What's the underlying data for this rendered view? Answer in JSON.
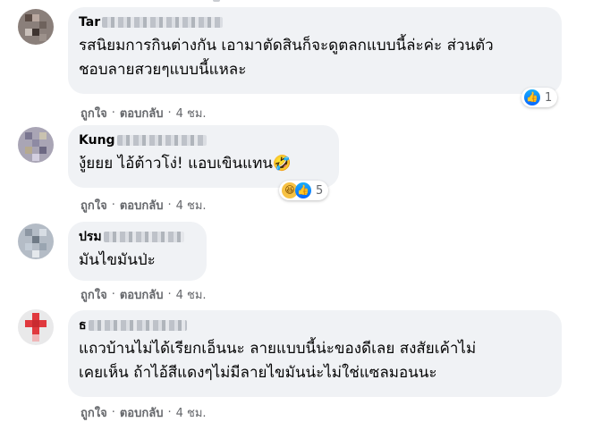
{
  "comments": [
    {
      "author_visible": "Tar",
      "text_lines": [
        "รสนิยมการกินต่างกัน เอามาตัดสินก็จะดูตลกแบบนี้ล่ะค่ะ ส่วนตัว",
        "ชอบลายสวยๆแบบนี้แหละ"
      ],
      "like_label": "ถูกใจ",
      "reply_label": "ตอบกลับ",
      "time": "4 ชม.",
      "reactions": {
        "icons": [
          "like-icon"
        ],
        "count": "1"
      }
    },
    {
      "author_visible": "Kung",
      "text_lines": [
        "งู้ยยย ไอ้ต้าวโง่! แอบเขินแทน🤣"
      ],
      "like_label": "ถูกใจ",
      "reply_label": "ตอบกลับ",
      "time": "4 ชม.",
      "reactions": {
        "icons": [
          "haha-icon",
          "like-icon"
        ],
        "count": "5"
      }
    },
    {
      "author_visible": "ปรม",
      "text_lines": [
        "มันไขมันป่ะ"
      ],
      "like_label": "ถูกใจ",
      "reply_label": "ตอบกลับ",
      "time": "4 ชม."
    },
    {
      "author_visible": "ธ",
      "text_lines": [
        "แถวบ้านไม่ได้เรียกเอ็นนะ ลายแบบนี้น่ะของดีเลย สงสัยเค้าไม่",
        "เคยเห็น ถ้าไอ้สีแดงๆไม่มีลายไขมันน่ะไม่ใช่แซลมอนนะ"
      ],
      "like_label": "ถูกใจ",
      "reply_label": "ตอบกลับ",
      "time": "4 ชม."
    }
  ],
  "separator": "·",
  "colors": {
    "bubble": "#f0f2f5",
    "meta": "#65676b",
    "like_blue": "#0866ff",
    "haha_yellow": "#f7c244"
  }
}
